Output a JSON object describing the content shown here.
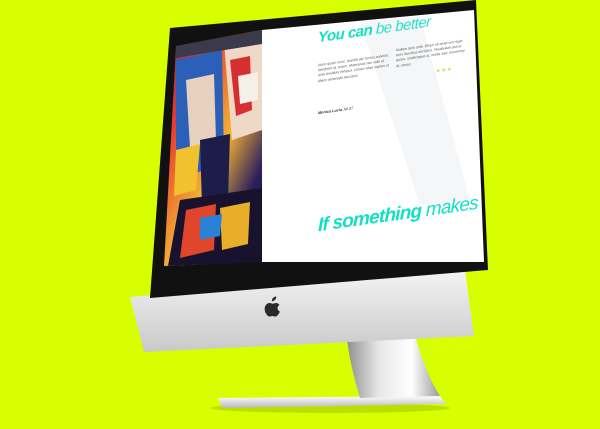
{
  "heading_top": {
    "strong": "You can",
    "light": "be better"
  },
  "para_left": "Nunc quam nunc, blandit vel, luctus pulvinar, hendrerit id, lorem. Maecenas nec odio et ante tincidunt tempus. Donec vitae sapien ut libero venenatis faucibus.",
  "para_right": "Nullam quis ante. Etiam sit amet orci eget eros faucibus tincidunt. Vestibulum purus quam, scelerisque ut, mollis sed, nonummy id, metus.",
  "author": {
    "name": "Monica Lucia",
    "date": "Jul 27"
  },
  "stars": "★★★",
  "heading_bottom": {
    "strong": "If something",
    "light": "makes"
  },
  "colors": {
    "background": "#d8ff00",
    "accent": "#12e0c4"
  },
  "icons": {
    "brand_logo": "apple-logo-icon"
  }
}
